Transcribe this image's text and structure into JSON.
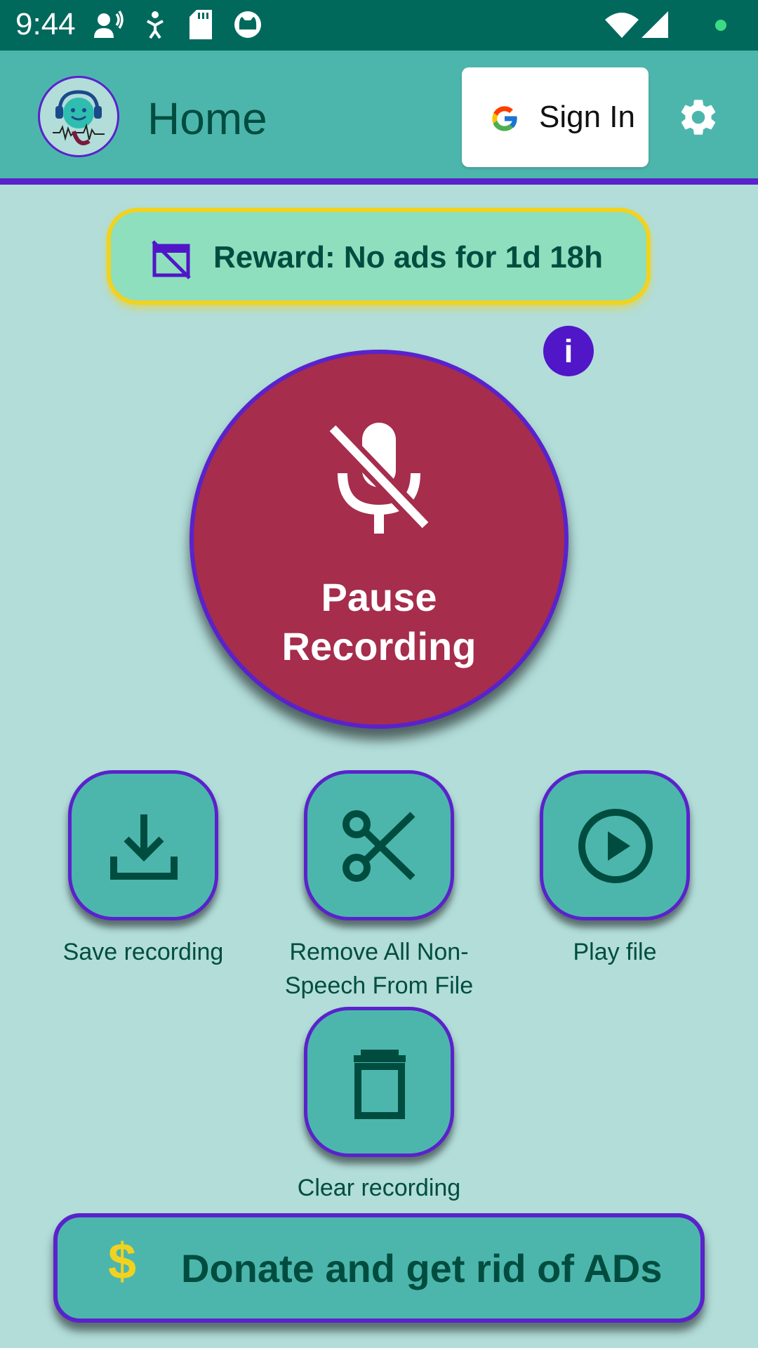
{
  "status_bar": {
    "time": "9:44",
    "icons": [
      "assistant-icon",
      "accessibility-icon",
      "sd-card-icon",
      "cat-icon",
      "wifi-icon",
      "signal-icon",
      "dot-icon"
    ]
  },
  "app_bar": {
    "title": "Home",
    "sign_in_label": "Sign In",
    "colors": {
      "bar": "#4db6ac",
      "border": "#5a22cc",
      "title": "#004d40"
    }
  },
  "reward": {
    "label": "Reward: No ads for 1d 18h",
    "icon": "no-ads-icon"
  },
  "info_button": {
    "label": "i"
  },
  "record_button": {
    "label_line1": "Pause",
    "label_line2": "Recording",
    "icon": "mic-off-icon",
    "color": "#a62d4c"
  },
  "actions": [
    {
      "label": "Save recording",
      "icon": "download-icon"
    },
    {
      "label": "Remove All Non-Speech From File",
      "icon": "scissors-icon"
    },
    {
      "label": "Play file",
      "icon": "play-circle-icon"
    },
    {
      "label": "Clear recording",
      "icon": "trash-icon"
    }
  ],
  "donate": {
    "symbol": "$",
    "label": "Donate and get rid of ADs"
  }
}
